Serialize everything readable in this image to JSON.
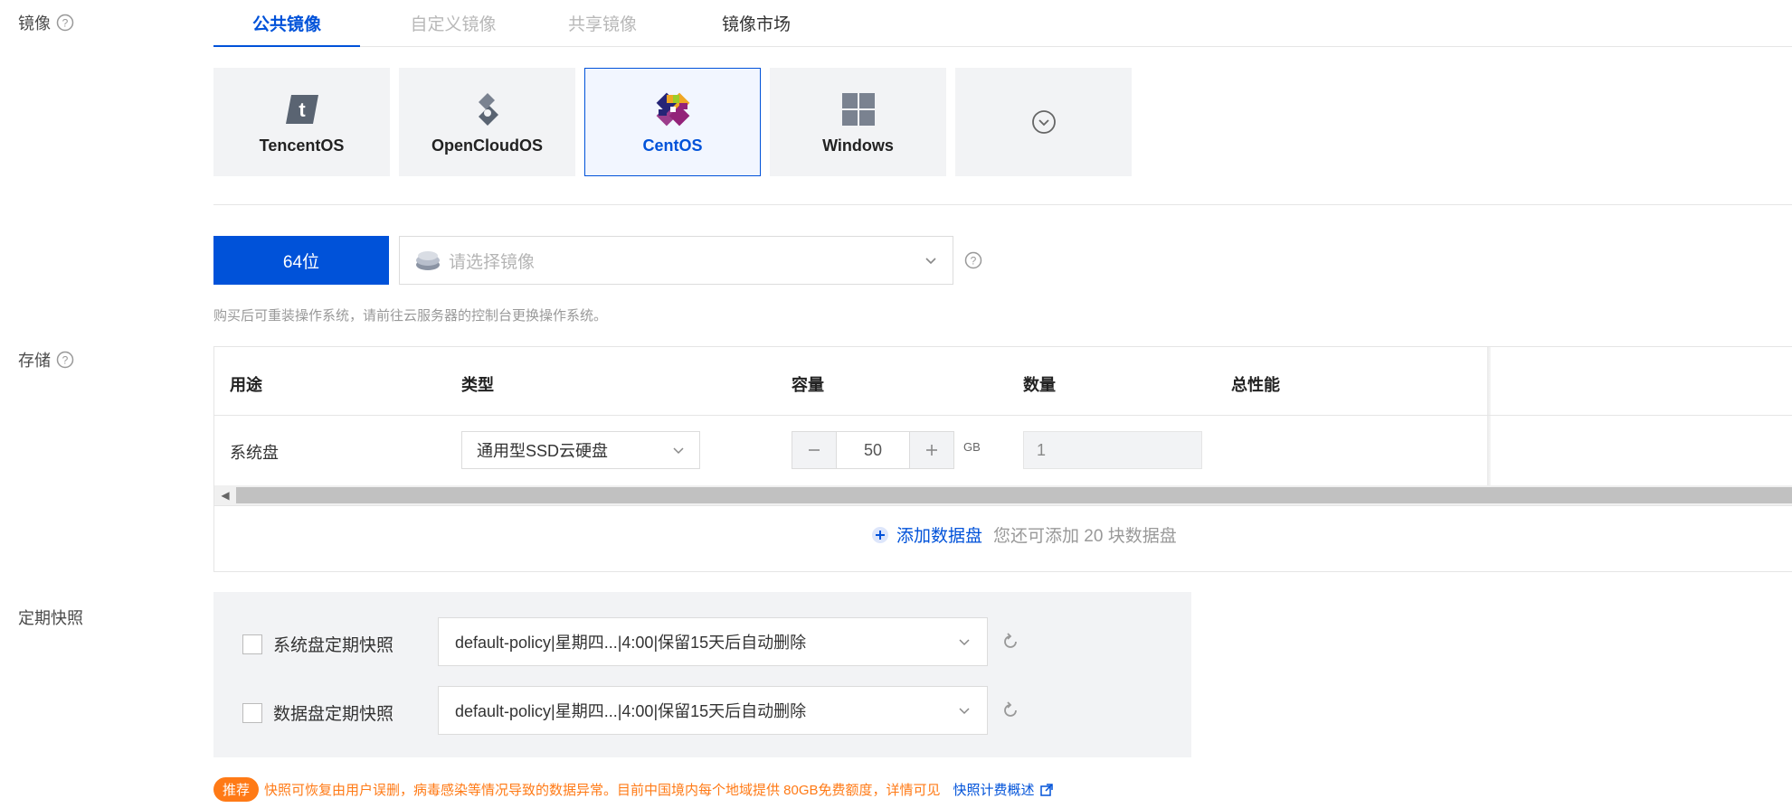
{
  "sections": {
    "image_label": "镜像",
    "storage_label": "存储",
    "snapshot_label": "定期快照"
  },
  "image_tabs": [
    {
      "label": "公共镜像",
      "state": "active"
    },
    {
      "label": "自定义镜像",
      "state": "disabled"
    },
    {
      "label": "共享镜像",
      "state": "disabled"
    },
    {
      "label": "镜像市场",
      "state": "normal"
    }
  ],
  "os_cards": [
    {
      "name": "TencentOS",
      "icon": "tencentos-logo-icon",
      "selected": false
    },
    {
      "name": "OpenCloudOS",
      "icon": "opencloudos-logo-icon",
      "selected": false
    },
    {
      "name": "CentOS",
      "icon": "centos-logo-icon",
      "selected": true
    },
    {
      "name": "Windows",
      "icon": "windows-logo-icon",
      "selected": false
    }
  ],
  "architecture": {
    "label": "64位"
  },
  "image_select": {
    "placeholder": "请选择镜像"
  },
  "image_hint": "购买后可重装操作系统，请前往云服务器的控制台更换操作系统。",
  "storage": {
    "columns": [
      "用途",
      "类型",
      "容量",
      "数量",
      "总性能"
    ],
    "rows": [
      {
        "usage": "系统盘",
        "type": "通用型SSD云硬盘",
        "capacity": "50",
        "unit": "GB",
        "quantity": "1"
      }
    ],
    "add_disk_label": "添加数据盘",
    "add_disk_remaining": "您还可添加 20 块数据盘"
  },
  "snapshot": {
    "rows": [
      {
        "label": "系统盘定期快照",
        "policy": "default-policy|星期四...|4:00|保留15天后自动删除"
      },
      {
        "label": "数据盘定期快照",
        "policy": "default-policy|星期四...|4:00|保留15天后自动删除"
      }
    ]
  },
  "recommend": {
    "badge": "推荐",
    "text": "快照可恢复由用户误删，病毒感染等情况导致的数据异常。目前中国境内每个地域提供 80GB免费额度，详情可见",
    "link": "快照计费概述"
  },
  "colors": {
    "primary": "#0052d9",
    "warning": "#ff7a16",
    "panel": "#f2f3f5"
  }
}
